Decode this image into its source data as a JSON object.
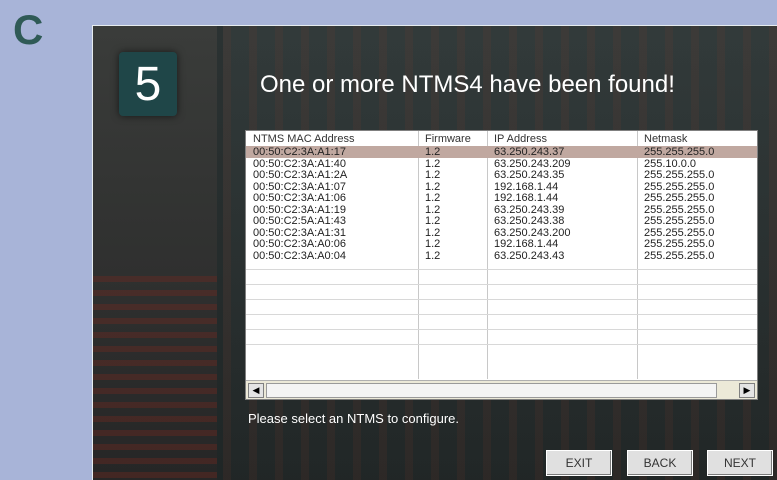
{
  "figure_label": "C",
  "wizard": {
    "step_number": "5",
    "title": "One or more NTMS4 have been found!",
    "prompt": "Please select an NTMS to configure.",
    "buttons": {
      "exit": "EXIT",
      "back": "BACK",
      "next": "NEXT"
    }
  },
  "table": {
    "columns": [
      "NTMS MAC Address",
      "Firmware",
      "IP Address",
      "Netmask"
    ],
    "selected_row": 0,
    "rows": [
      {
        "mac": "00:50:C2:3A:A1:17",
        "fw": "1.2",
        "ip": "63.250.243.37",
        "mask": "255.255.255.0"
      },
      {
        "mac": "00:50:C2:3A:A1:40",
        "fw": "1.2",
        "ip": "63.250.243.209",
        "mask": "255.10.0.0"
      },
      {
        "mac": "00:50:C2:3A:A1:2A",
        "fw": "1.2",
        "ip": "63.250.243.35",
        "mask": "255.255.255.0"
      },
      {
        "mac": "00:50:C2:3A:A1:07",
        "fw": "1.2",
        "ip": "192.168.1.44",
        "mask": "255.255.255.0"
      },
      {
        "mac": "00:50:C2:3A:A1:06",
        "fw": "1.2",
        "ip": "192.168.1.44",
        "mask": "255.255.255.0"
      },
      {
        "mac": "00:50:C2:3A:A1:19",
        "fw": "1.2",
        "ip": "63.250.243.39",
        "mask": "255.255.255.0"
      },
      {
        "mac": "00:50:C2:5A:A1:43",
        "fw": "1.2",
        "ip": "63.250.243.38",
        "mask": "255.255.255.0"
      },
      {
        "mac": "00:50:C2:3A:A1:31",
        "fw": "1.2",
        "ip": "63.250.243.200",
        "mask": "255.255.255.0"
      },
      {
        "mac": "00:50:C2:3A:A0:06",
        "fw": "1.2",
        "ip": "192.168.1.44",
        "mask": "255.255.255.0"
      },
      {
        "mac": "00:50:C2:3A:A0:04",
        "fw": "1.2",
        "ip": "63.250.243.43",
        "mask": "255.255.255.0"
      }
    ]
  },
  "scrollbar": {
    "left_icon": "arrow-left-icon",
    "right_icon": "arrow-right-icon"
  },
  "colors": {
    "background": "#a8b4d8",
    "badge": "#1f4648",
    "selection": "#c0a8a0"
  }
}
